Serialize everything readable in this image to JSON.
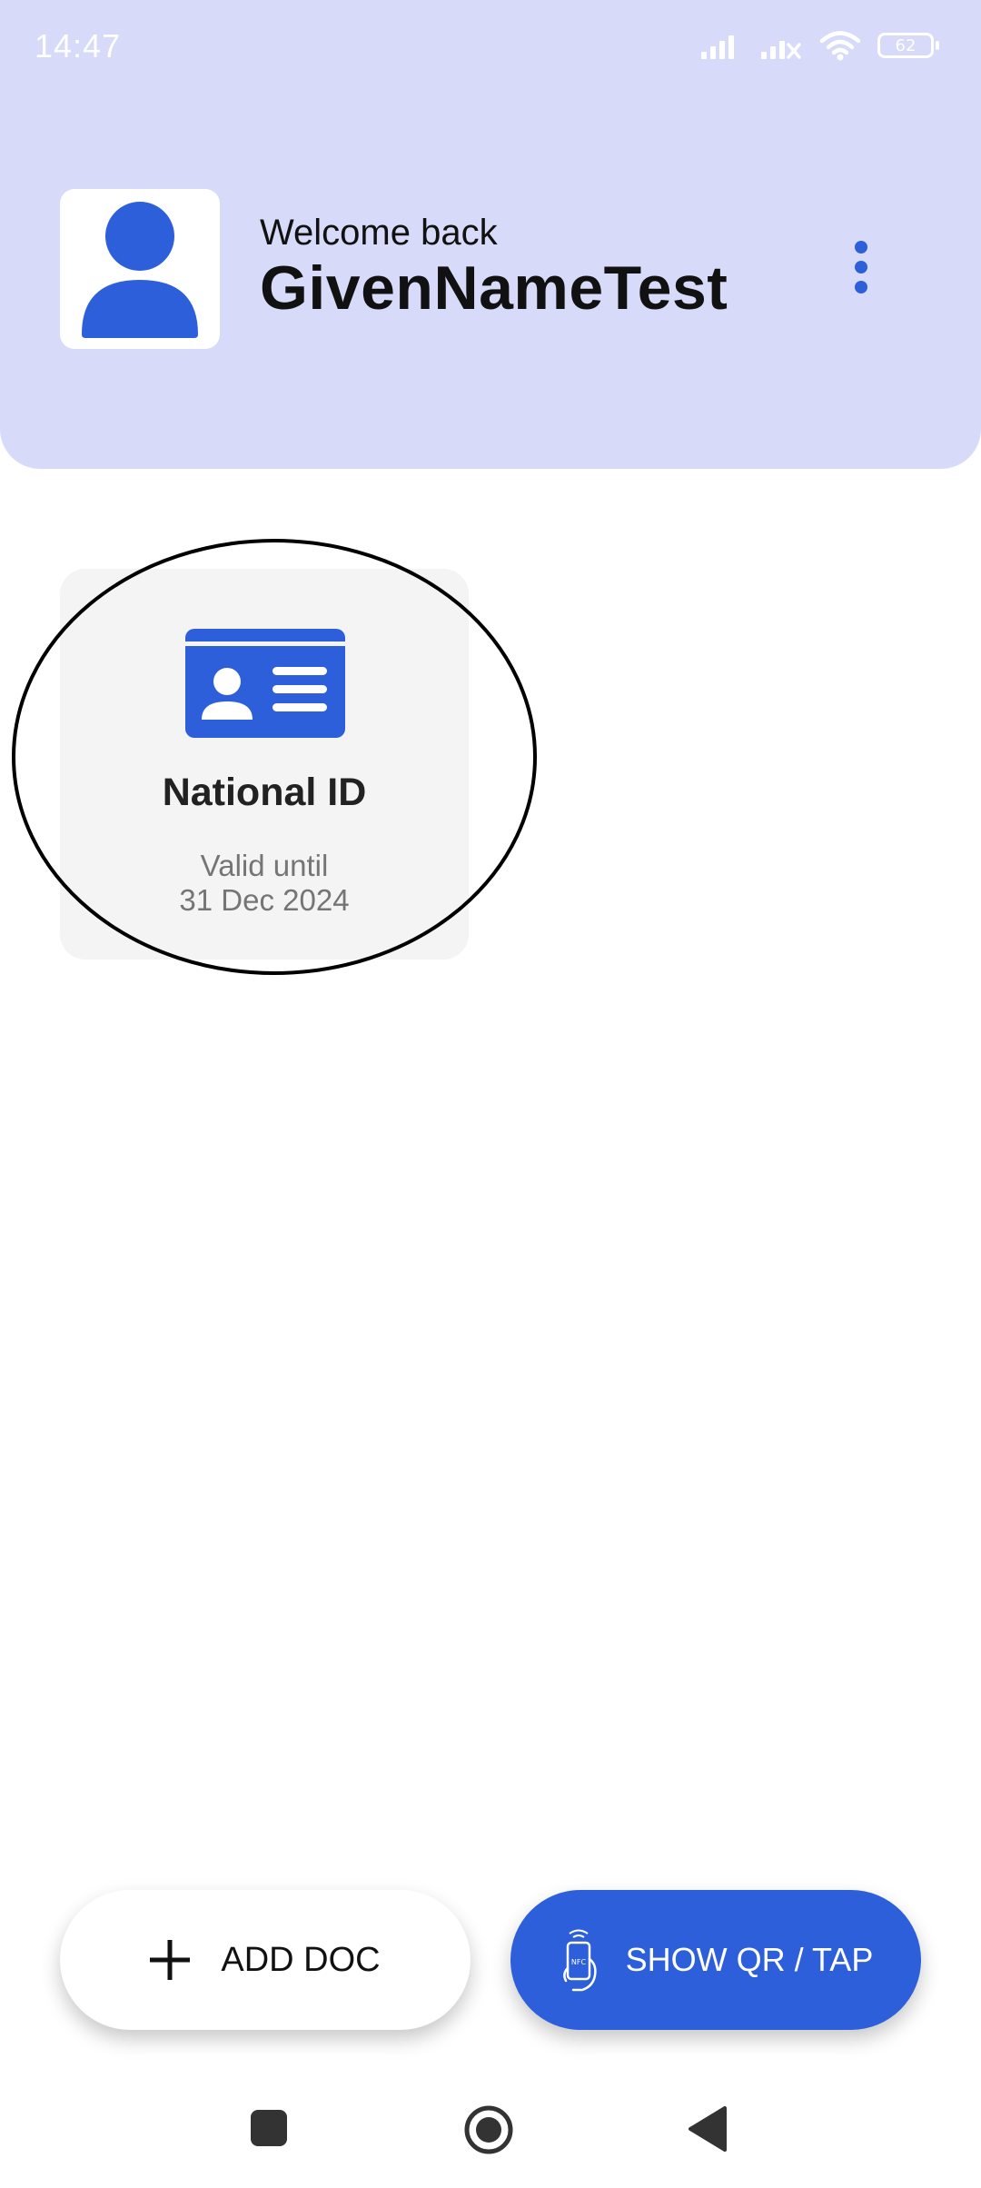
{
  "status_bar": {
    "time": "14:47",
    "battery_level": "62",
    "icons": [
      "signal-icon",
      "signal-no-sim-icon",
      "wifi-icon",
      "battery-icon"
    ]
  },
  "header": {
    "welcome": "Welcome back",
    "user_name": "GivenNameTest",
    "avatar_icon": "person-icon",
    "menu_icon": "more-vert-icon"
  },
  "documents": [
    {
      "icon": "id-card-icon",
      "title": "National ID",
      "valid_label": "Valid until",
      "valid_date": "31 Dec 2024"
    }
  ],
  "actions": {
    "add_doc_label": "ADD DOC",
    "add_doc_icon": "plus-icon",
    "show_qr_label": "SHOW QR / TAP",
    "show_qr_icon": "nfc-phone-icon"
  },
  "navigation": {
    "icons": [
      "recents-icon",
      "home-icon",
      "back-icon"
    ]
  },
  "colors": {
    "header_background": "#d7daf8",
    "accent": "#2c5fd9",
    "card_background": "#f4f4f4"
  }
}
